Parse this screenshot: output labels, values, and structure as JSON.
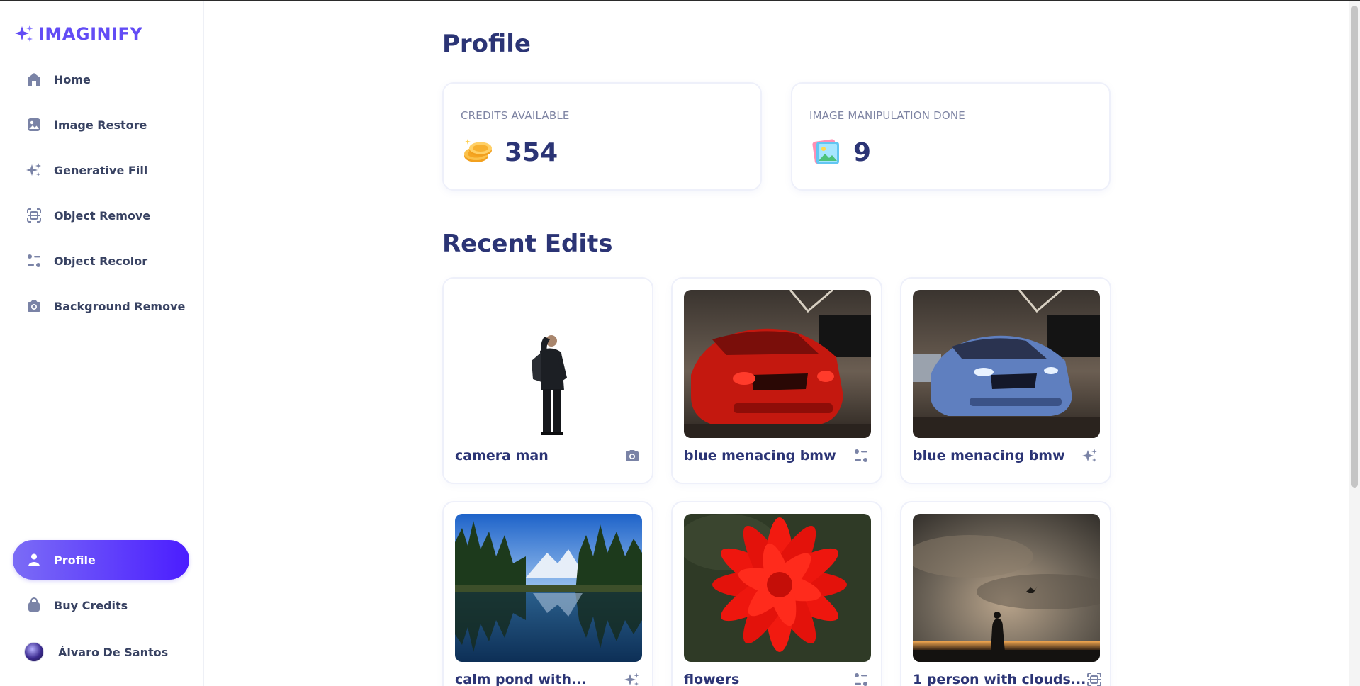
{
  "app": {
    "name": "IMAGINIFY"
  },
  "sidebar": {
    "items": [
      {
        "label": "Home",
        "icon": "home-icon"
      },
      {
        "label": "Image Restore",
        "icon": "image-icon"
      },
      {
        "label": "Generative Fill",
        "icon": "stars-icon"
      },
      {
        "label": "Object Remove",
        "icon": "scan-icon"
      },
      {
        "label": "Object Recolor",
        "icon": "filter-icon"
      },
      {
        "label": "Background Remove",
        "icon": "camera-icon"
      }
    ],
    "bottom": [
      {
        "label": "Profile",
        "icon": "profile-icon",
        "active": true
      },
      {
        "label": "Buy Credits",
        "icon": "bag-icon"
      }
    ],
    "user": {
      "name": "Álvaro De Santos"
    }
  },
  "profile": {
    "title": "Profile",
    "credits": {
      "label": "CREDITS AVAILABLE",
      "value": "354",
      "icon": "coins-icon"
    },
    "manipulations": {
      "label": "IMAGE MANIPULATION DONE",
      "value": "9",
      "icon": "photo-icon"
    }
  },
  "recent": {
    "title": "Recent Edits",
    "items": [
      {
        "title": "camera man",
        "icon": "camera-icon"
      },
      {
        "title": "blue menacing bmw",
        "icon": "filter-icon"
      },
      {
        "title": "blue menacing bmw",
        "icon": "stars-icon"
      },
      {
        "title": "calm pond with...",
        "icon": "stars-icon"
      },
      {
        "title": "flowers",
        "icon": "filter-icon"
      },
      {
        "title": "1 person with clouds...",
        "icon": "scan-icon"
      }
    ]
  },
  "colors": {
    "accent": "#624cf5",
    "heading": "#2b3475",
    "nav_text": "#384262",
    "active_start": "#7b6cf6",
    "active_end": "#4b1dff"
  }
}
